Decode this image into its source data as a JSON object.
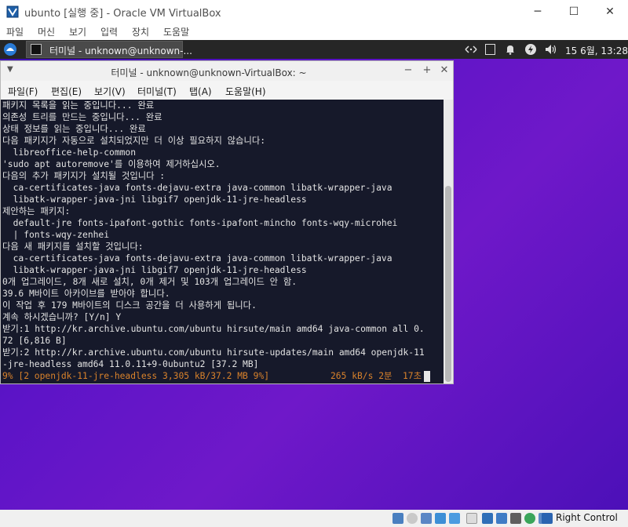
{
  "host_window": {
    "title": "ubunto [실행 중] - Oracle VM VirtualBox",
    "controls": {
      "minimize": "─",
      "maximize": "☐",
      "close": "✕"
    }
  },
  "host_menu": [
    "파일",
    "머신",
    "보기",
    "입력",
    "장치",
    "도움말"
  ],
  "guest_panel": {
    "taskbar_item": "터미널 - unknown@unknown-...",
    "clock": "15  6월, 13:28",
    "tray_icons": [
      "network-icon",
      "keyboard-layout-icon",
      "notification-bell-icon",
      "power-icon",
      "volume-icon"
    ]
  },
  "terminal": {
    "title": "터미널 - unknown@unknown-VirtualBox: ~",
    "menu": [
      "파일(F)",
      "편집(E)",
      "보기(V)",
      "터미널(T)",
      "탭(A)",
      "도움말(H)"
    ],
    "lines": [
      "패키지 목록을 읽는 중입니다... 완료",
      "의존성 트리를 만드는 중입니다... 완료",
      "상태 정보를 읽는 중입니다... 완료",
      "다음 패키지가 자동으로 설치되었지만 더 이상 필요하지 않습니다:",
      "  libreoffice-help-common",
      "'sudo apt autoremove'를 이용하여 제거하십시오.",
      "다음의 추가 패키지가 설치될 것입니다 :",
      "  ca-certificates-java fonts-dejavu-extra java-common libatk-wrapper-java",
      "  libatk-wrapper-java-jni libgif7 openjdk-11-jre-headless",
      "제안하는 패키지:",
      "  default-jre fonts-ipafont-gothic fonts-ipafont-mincho fonts-wqy-microhei",
      "  | fonts-wqy-zenhei",
      "다음 새 패키지를 설치할 것입니다:",
      "  ca-certificates-java fonts-dejavu-extra java-common libatk-wrapper-java",
      "  libatk-wrapper-java-jni libgif7 openjdk-11-jre-headless",
      "0개 업그레이드, 8개 새로 설치, 0개 제거 및 103개 업그레이드 안 함.",
      "39.6 M바이트 아카이브를 받아야 합니다.",
      "이 작업 후 179 M바이트의 디스크 공간을 더 사용하게 됩니다.",
      "계속 하시겠습니까? [Y/n] Y",
      "받기:1 http://kr.archive.ubuntu.com/ubuntu hirsute/main amd64 java-common all 0.",
      "72 [6,816 B]",
      "받기:2 http://kr.archive.ubuntu.com/ubuntu hirsute-updates/main amd64 openjdk-11",
      "-jre-headless amd64 11.0.11+9-0ubuntu2 [37.2 MB]"
    ],
    "progress_line": "9% [2 openjdk-11-jre-headless 3,305 kB/37.2 MB 9%]",
    "progress_rate": "265 kB/s 2분  17초"
  },
  "statusbar": {
    "host_key": "Right Control",
    "icons": [
      "hard-disk-icon",
      "optical-disk-icon",
      "audio-icon",
      "network-adapter-icon",
      "usb-icon",
      "shared-folder-icon",
      "display-icon",
      "video-capture-icon",
      "recording-icon",
      "guest-additions-icon",
      "cpu-icon",
      "mouse-integration-icon",
      "keyboard-capture-icon"
    ]
  },
  "colors": {
    "desktop": "#5d14c7",
    "terminal_bg": "#16192a",
    "terminal_fg": "#e3e3e3",
    "progress_text": "#d9822b"
  }
}
